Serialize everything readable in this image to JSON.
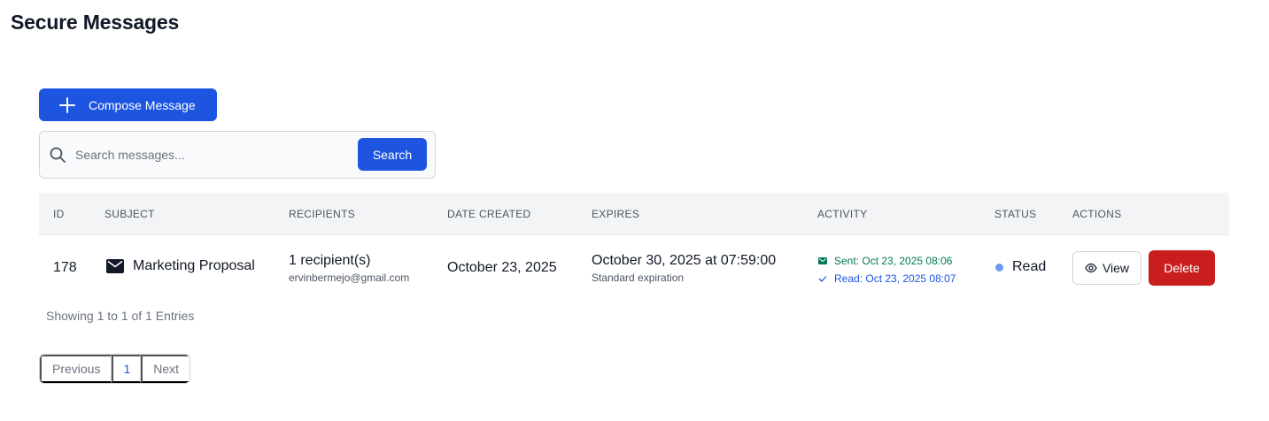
{
  "page": {
    "title": "Secure Messages"
  },
  "toolbar": {
    "compose_label": "Compose Message"
  },
  "search": {
    "placeholder": "Search messages...",
    "value": "",
    "button_label": "Search"
  },
  "table": {
    "headers": [
      "ID",
      "SUBJECT",
      "RECIPIENTS",
      "DATE CREATED",
      "EXPIRES",
      "ACTIVITY",
      "STATUS",
      "ACTIONS"
    ],
    "rows": [
      {
        "id": "178",
        "subject": "Marketing Proposal",
        "recipients": "1 recipient(s)",
        "recipient_email": "ervinbermejo@gmail.com",
        "date_created": "October 23, 2025",
        "expires": "October 30, 2025 at 07:59:00",
        "expiration_type": "Standard expiration",
        "activity_sent": "Sent: Oct 23, 2025 08:06",
        "activity_read": "Read: Oct 23, 2025 08:07",
        "status": "Read",
        "view_label": "View",
        "delete_label": "Delete"
      }
    ]
  },
  "footer": {
    "showing": "Showing 1 to 1 of 1 Entries"
  },
  "pagination": {
    "previous": "Previous",
    "current": "1",
    "next": "Next"
  },
  "icons": {
    "compose": "plus-icon",
    "search": "search-icon",
    "subject": "envelope-icon",
    "sent": "envelope-small-icon",
    "read": "check-icon",
    "status": "dot-icon",
    "view": "eye-icon"
  },
  "colors": {
    "primary": "#1d55e0",
    "danger": "#c81e1e",
    "sent": "#047857",
    "read": "#1d55e0",
    "status_dot": "#6b9bf0"
  }
}
